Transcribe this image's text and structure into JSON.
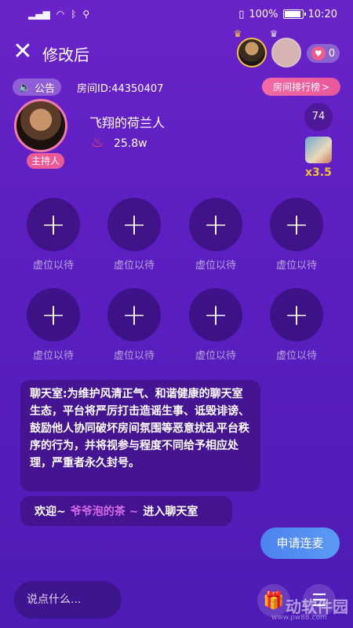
{
  "status_bar": {
    "icons": [
      "wifi-icon",
      "bluetooth-icon",
      "usb-icon",
      "vibrate-icon"
    ],
    "battery_percent": "100%",
    "battery_level": 1.0,
    "time": "10:20"
  },
  "header": {
    "close_icon": "close-icon",
    "title": "修改后",
    "like_count": "0"
  },
  "notice": {
    "label": "公告",
    "room_id": "房间ID:44350407",
    "rank_label": "房间排行榜",
    "rank_arrow": ">"
  },
  "host": {
    "tag": "主持人",
    "name": "飞翔的荷兰人",
    "hot_value": "25.8w",
    "count": "74",
    "multiplier": "x3.5"
  },
  "seats": [
    {
      "plus": "+",
      "label": "虚位以待"
    },
    {
      "plus": "+",
      "label": "虚位以待"
    },
    {
      "plus": "+",
      "label": "虚位以待"
    },
    {
      "plus": "+",
      "label": "虚位以待"
    },
    {
      "plus": "+",
      "label": "虚位以待"
    },
    {
      "plus": "+",
      "label": "虚位以待"
    },
    {
      "plus": "+",
      "label": "虚位以待"
    },
    {
      "plus": "+",
      "label": "虚位以待"
    }
  ],
  "chat": {
    "rules": "聊天室:为维护风清正气、和谐健康的聊天室生态，平台将严厉打击造谣生事、诋毁诽谤、鼓励他人协同破坏房间氛围等恶意扰乱平台秩序的行为，并将视参与程度不同给予相应处理，严重者永久封号。",
    "welcome_prefix": "欢迎~",
    "welcome_user": "爷爷泡的茶 ~",
    "welcome_suffix": "进入聊天室"
  },
  "actions": {
    "apply_label": "申请连麦",
    "input_placeholder": "说点什么...",
    "gift_icon": "gift-icon",
    "menu_icon": "menu-icon"
  },
  "watermark": {
    "text": "动软件园",
    "url": "www.pw88.com"
  }
}
